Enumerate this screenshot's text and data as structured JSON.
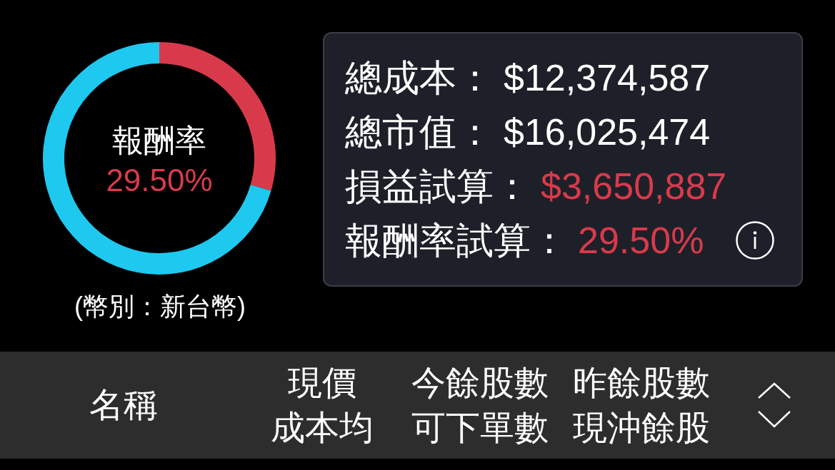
{
  "summary_chart": {
    "chart_data": {
      "type": "donut",
      "values": [
        29.5,
        70.5
      ],
      "colors": [
        "#d93a4b",
        "#1ec8ee"
      ]
    },
    "center_label": "報酬率",
    "center_value": "29.50%"
  },
  "currency_note": "(幣別：新台幣)",
  "summary_card": {
    "rows": [
      {
        "label": "總成本：",
        "value": "$12,374,587",
        "color": "#ffffff",
        "info": false
      },
      {
        "label": "總市值：",
        "value": "$16,025,474",
        "color": "#ffffff",
        "info": false
      },
      {
        "label": "損益試算：",
        "value": "$3,650,887",
        "color": "#d93a4b",
        "info": false
      },
      {
        "label": "報酬率試算：",
        "value": "29.50%",
        "color": "#d93a4b",
        "info": true
      }
    ]
  },
  "table_header": {
    "name_column": "名稱",
    "columns": [
      {
        "top": "現價",
        "bottom": "成本均"
      },
      {
        "top": "今餘股數",
        "bottom": "可下單數"
      },
      {
        "top": "昨餘股數",
        "bottom": "現沖餘股"
      }
    ]
  }
}
